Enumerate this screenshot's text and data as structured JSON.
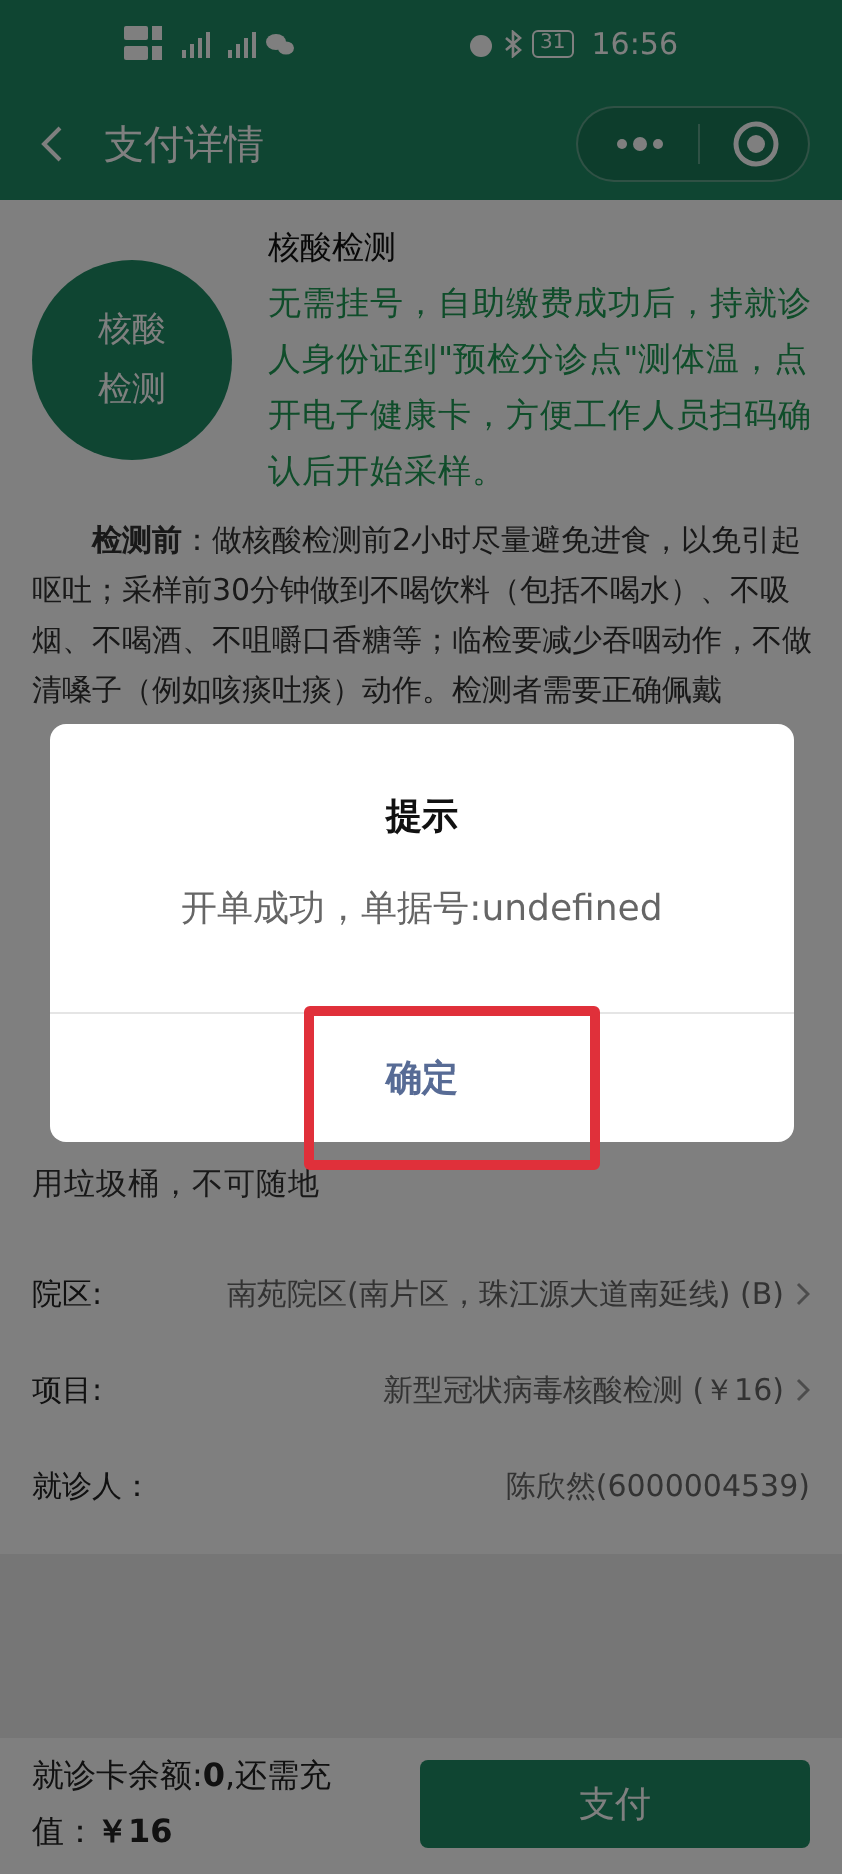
{
  "status_bar": {
    "battery": "31",
    "time": "16:56"
  },
  "nav": {
    "title": "支付详情"
  },
  "test": {
    "badge_lines": [
      "核酸",
      "检测"
    ],
    "title": "核酸检测",
    "notice": "无需挂号，自助缴费成功后，持就诊人身份证到\"预检分诊点\"测体温，点开电子健康卡，方便工作人员扫码确认后开始采样。"
  },
  "instructions": [
    {
      "text": "**检测前**：做核酸检测前2小时尽量避免进食，以免引起呕吐；采样前30分钟做到不喝饮料（包括不喝水）、不吸烟、不喝酒、不咀嚼口香糖等；临检要减少吞咽动作，不做清嗓子（例如咳痰吐痰）动作。检测者需要正确佩戴"
    },
    {
      "text": "用垃圾桶，不可随地"
    }
  ],
  "fields": [
    {
      "label": "院区:",
      "value": "南苑院区(南片区，珠江源大道南延线) (B)",
      "chevron": true
    },
    {
      "label": "项目:",
      "value": "新型冠状病毒核酸检测 (￥16)",
      "chevron": true
    },
    {
      "label": "就诊人：",
      "value": "陈欣然(6000004539)",
      "chevron": false
    }
  ],
  "footer": {
    "balance": "就诊卡余额:**0**,还需充值：**￥16**",
    "pay_button": "支付"
  },
  "dialog": {
    "title": "提示",
    "message": "开单成功，单据号:undefined",
    "confirm": "确定",
    "highlighted": true
  }
}
